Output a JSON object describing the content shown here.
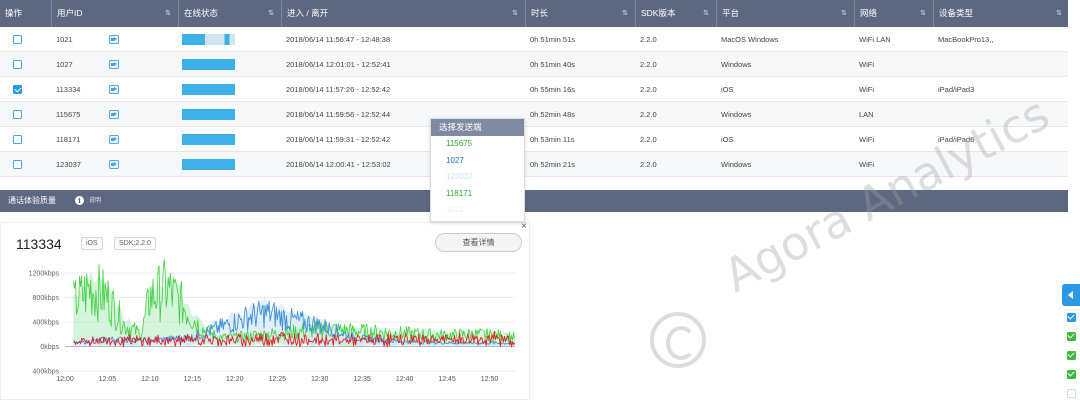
{
  "table": {
    "headers": [
      "操作",
      "用户ID",
      "在线状态",
      "进入 / 离开",
      "时长",
      "SDK版本",
      "平台",
      "网络",
      "设备类型"
    ],
    "sort_glyph": "⇅",
    "rows": [
      {
        "checked": false,
        "uid": "1021",
        "status": "mixed",
        "time": "2018/06/14 11:56:47 - 12:48:38",
        "duration": "0h 51min 51s",
        "sdk": "2.2.0",
        "platform": "MacOS Windows",
        "network": "WiFi LAN",
        "device": "MacBookPro13,,"
      },
      {
        "checked": false,
        "uid": "1027",
        "status": "online",
        "time": "2018/06/14 12:01:01 - 12:52:41",
        "duration": "0h 51min 40s",
        "sdk": "2.2.0",
        "platform": "Windows",
        "network": "WiFi",
        "device": ""
      },
      {
        "checked": true,
        "uid": "113334",
        "status": "online",
        "time": "2018/06/14 11:57:26 - 12:52:42",
        "duration": "0h 55min 16s",
        "sdk": "2.2.0",
        "platform": "iOS",
        "network": "WiFi",
        "device": "iPad/iPad3"
      },
      {
        "checked": false,
        "uid": "115675",
        "status": "online",
        "time": "2018/06/14 11:59:56 - 12:52:44",
        "duration": "0h 52min 48s",
        "sdk": "2.2.0",
        "platform": "Windows",
        "network": "LAN",
        "device": ""
      },
      {
        "checked": false,
        "uid": "118171",
        "status": "online",
        "time": "2018/06/14 11:59:31 - 12:52:42",
        "duration": "0h 53min 11s",
        "sdk": "2.2.0",
        "platform": "iOS",
        "network": "WiFi",
        "device": "iPad/iPad6"
      },
      {
        "checked": false,
        "uid": "123037",
        "status": "online",
        "time": "2018/06/14 12:00:41 - 12:53:02",
        "duration": "0h 52min 21s",
        "sdk": "2.2.0",
        "platform": "Windows",
        "network": "WiFi",
        "device": ""
      }
    ]
  },
  "panel": {
    "title": "通话体验质量",
    "info_icon": "i",
    "hint": "说明",
    "uid": "113334",
    "platform_tag": "iOS",
    "sdk_tag": "SDK:2.2.0",
    "detail_button": "查看详情",
    "close_glyph": "×"
  },
  "popup": {
    "title": "选择发送端",
    "items": [
      {
        "label": "115675",
        "color": "#2fae2f"
      },
      {
        "label": "1027",
        "color": "#2b72c9"
      },
      {
        "label": "123037",
        "color": "#cfe2ef"
      },
      {
        "label": "118171",
        "color": "#39a839"
      },
      {
        "label": "1021",
        "color": "#ececec"
      }
    ]
  },
  "watermark": {
    "text": "Agora Analytics"
  },
  "colors": {
    "header_bg": "#5d6880",
    "accent": "#2b9ae4",
    "status_bar": "#3eb0e8",
    "series": {
      "green": "#3ed03e",
      "blue": "#3f8fd8",
      "light_green": "#b9ecc4",
      "light_blue": "#cde6f7",
      "red": "#e02020"
    }
  },
  "side_panel": {
    "checkboxes": [
      {
        "checked": true,
        "color": "#2b9ae4"
      },
      {
        "checked": true,
        "color": "#3fba3f"
      },
      {
        "checked": true,
        "color": "#3fba3f"
      },
      {
        "checked": true,
        "color": "#3fba3f"
      },
      {
        "checked": false,
        "color": "#c9dce9"
      }
    ]
  },
  "chart_data": {
    "type": "line",
    "title": "",
    "xlabel": "",
    "ylabel": "",
    "y_tick_labels": [
      "1200kbps",
      "800kbps",
      "400kbps",
      "0kbps",
      "400kbps"
    ],
    "y_ticks": [
      1200,
      800,
      400,
      0,
      -400
    ],
    "ylim": [
      -400,
      1200
    ],
    "x_ticks": [
      "12:00",
      "12:05",
      "12:10",
      "12:15",
      "12:20",
      "12:25",
      "12:30",
      "12:35",
      "12:40",
      "12:45",
      "12:50"
    ],
    "x_range_minutes": [
      0,
      53
    ],
    "grid": "horizontal",
    "legend": "none",
    "series": [
      {
        "color": "#3ed03e",
        "minutes": [
          1,
          3,
          5,
          7,
          9,
          10,
          12,
          14,
          16,
          18,
          20,
          22,
          24,
          26,
          28,
          30,
          33,
          36,
          39,
          42,
          45,
          48,
          51,
          53
        ],
        "values": [
          700,
          950,
          800,
          350,
          200,
          800,
          950,
          650,
          300,
          150,
          150,
          180,
          200,
          220,
          250,
          300,
          260,
          240,
          220,
          200,
          180,
          200,
          180,
          150
        ]
      },
      {
        "color": "#3f8fd8",
        "minutes": [
          1,
          5,
          10,
          15,
          17,
          20,
          22,
          24,
          26,
          28,
          30,
          32,
          34,
          36,
          40,
          45,
          50,
          53
        ],
        "values": [
          50,
          120,
          100,
          150,
          250,
          400,
          500,
          550,
          450,
          400,
          350,
          250,
          150,
          120,
          80,
          60,
          60,
          50
        ]
      },
      {
        "color": "#e02020",
        "minutes": [
          1,
          5,
          10,
          15,
          20,
          25,
          30,
          35,
          40,
          45,
          50,
          53
        ],
        "values": [
          60,
          80,
          70,
          90,
          80,
          120,
          90,
          80,
          100,
          90,
          110,
          80
        ]
      }
    ]
  }
}
